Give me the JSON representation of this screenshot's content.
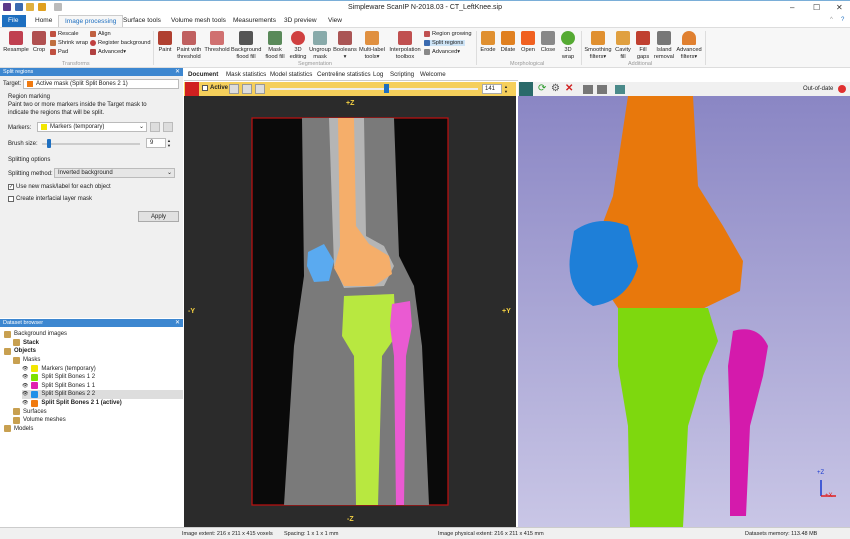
{
  "window": {
    "title": "Simpleware ScanIP N-2018.03 - CT_LeftKnee.sip"
  },
  "menu_tabs": [
    "File",
    "Home",
    "Image processing",
    "Surface tools",
    "Volume mesh tools",
    "Measurements",
    "3D preview",
    "View"
  ],
  "ribbon": {
    "transforms": {
      "big": [
        "Resample",
        "Crop"
      ],
      "small": [
        "Rescale",
        "Shrink wrap",
        "Pad",
        "Align",
        "Register background",
        "Advanced▾"
      ],
      "group": "Transforms"
    },
    "segmentation": {
      "big": [
        "Paint",
        "Paint with threshold",
        "Threshold",
        "Background flood fill",
        "Mask flood fill",
        "3D editing",
        "Ungroup mask",
        "Booleans ▾",
        "Multi-label tools▾",
        "Interpolation toolbox"
      ],
      "small": [
        "Region growing",
        "Split regions",
        "Advanced▾"
      ],
      "group": "Segmentation"
    },
    "morphological": {
      "big": [
        "Erode",
        "Dilate",
        "Open",
        "Close",
        "3D wrap"
      ],
      "group": "Morphological"
    },
    "additional": {
      "big": [
        "Smoothing filters▾",
        "Cavity fill",
        "Fill gaps",
        "Island removal",
        "Advanced filters▾"
      ],
      "group": "Additional"
    }
  },
  "split_panel": {
    "title": "Split regions",
    "target_label": "Target:",
    "target_value": "Active mask (Split Split Bones 2 1)",
    "section1": "Region marking",
    "instructions": "Paint two or more markers inside the Target mask to indicate the regions that will be split.",
    "markers_label": "Markers:",
    "markers_value": "Markers (temporary)",
    "brush_label": "Brush size:",
    "brush_value": "9",
    "brush_fraction": 0.05,
    "section2": "Splitting options",
    "method_label": "Splitting method:",
    "method_value": "Inverted background",
    "opt1": "Use new mask/label for each object",
    "opt1_checked": true,
    "opt2": "Create interfacial layer mask",
    "opt2_checked": false,
    "apply": "Apply"
  },
  "browser": {
    "title": "Dataset browser",
    "items": [
      {
        "label": "Background images",
        "level": 0,
        "bold": false
      },
      {
        "label": "Stack",
        "level": 1,
        "bold": true
      },
      {
        "label": "Objects",
        "level": 0,
        "bold": true
      },
      {
        "label": "Masks",
        "level": 1,
        "bold": false
      },
      {
        "label": "Markers (temporary)",
        "level": 2,
        "color": "#f2e600"
      },
      {
        "label": "Split Split Bones 1 2",
        "level": 2,
        "color": "#7ee000"
      },
      {
        "label": "Split Split Bones 1 1",
        "level": 2,
        "color": "#e020b0"
      },
      {
        "label": "Split Split Bones 2 2",
        "level": 2,
        "color": "#2090e8",
        "selected": true
      },
      {
        "label": "Split Split Bones 2 1 (active)",
        "level": 2,
        "color": "#f07a10",
        "bold": true
      },
      {
        "label": "Surfaces",
        "level": 1
      },
      {
        "label": "Volume meshes",
        "level": 1
      },
      {
        "label": "Models",
        "level": 0
      }
    ]
  },
  "doc_tabs": [
    "Document",
    "Mask statistics",
    "Model statistics",
    "Centreline statistics",
    "Log",
    "Scripting",
    "Welcome"
  ],
  "slice_toolbar": {
    "active_label": "Active",
    "slice": "141",
    "slider_fraction": 0.56
  },
  "view2d": {
    "top": "+Z",
    "bottom": "-Z",
    "left": "-Y",
    "right": "+Y"
  },
  "view3d": {
    "status": "Out-of-date",
    "axis_z": "+Z",
    "axis_x": "+X"
  },
  "statusbar": {
    "extent": "Image extent: 216 x 211 x 415 voxels",
    "spacing": "Spacing: 1 x 1 x 1 mm",
    "physical": "Image physical extent: 216 x 211 x 415 mm",
    "memory": "Datasets memory: 113.48 MB"
  },
  "colors": {
    "accent": "#1e6fc0",
    "toolbar": "#f5cf5b",
    "orange": "#f07a10",
    "blue": "#2090e8",
    "green": "#7ee000",
    "magenta": "#e020b0"
  }
}
